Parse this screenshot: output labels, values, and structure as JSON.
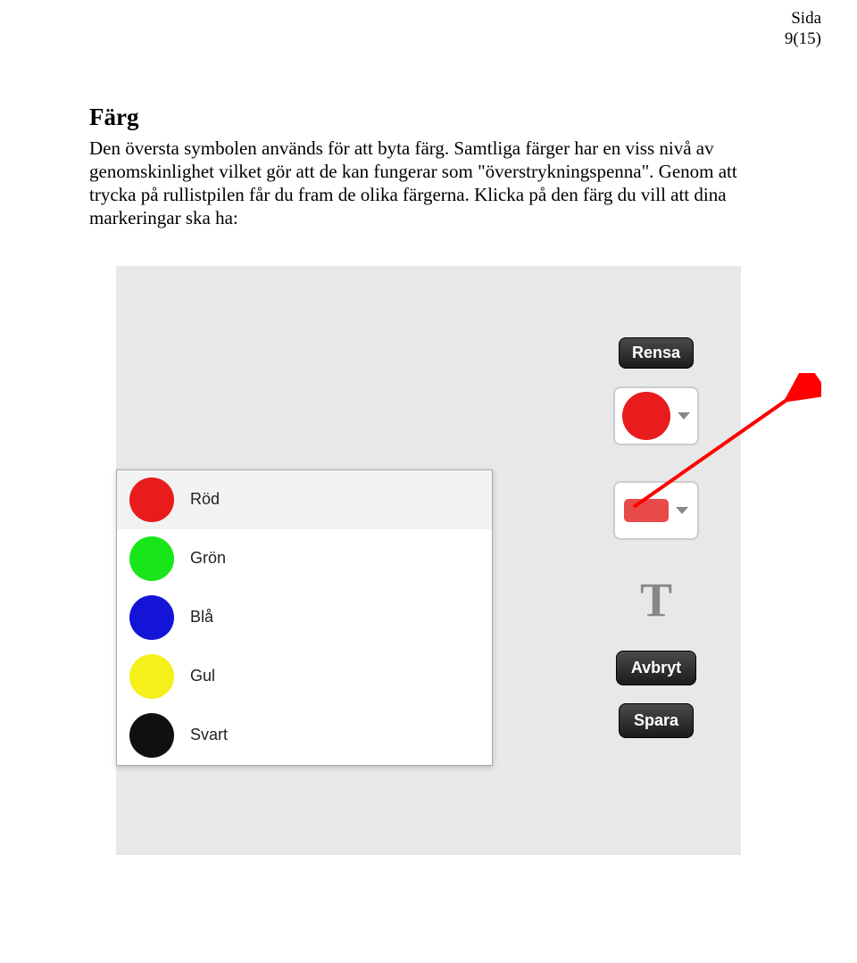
{
  "header": {
    "page_label": "Sida",
    "page_number": "9(15)"
  },
  "section": {
    "title": "Färg",
    "body": "Den översta symbolen används för att byta färg. Samtliga färger har en viss nivå av genomskinlighet vilket gör att de kan fungerar som \"överstrykningspenna\". Genom att trycka på rullistpilen får du fram de olika färgerna. Klicka på den färg du vill att dina markeringar ska ha:"
  },
  "ui": {
    "buttons": {
      "clear": "Rensa",
      "cancel": "Avbryt",
      "save": "Spara"
    },
    "text_tool": "T",
    "current_color": "#e81c1c",
    "rect_color": "#e84a4a",
    "colors": [
      {
        "label": "Röd",
        "hex": "#e81c1c",
        "highlight": true
      },
      {
        "label": "Grön",
        "hex": "#19e619",
        "highlight": false
      },
      {
        "label": "Blå",
        "hex": "#1414d6",
        "highlight": false
      },
      {
        "label": "Gul",
        "hex": "#f5ef1a",
        "highlight": false
      },
      {
        "label": "Svart",
        "hex": "#101010",
        "highlight": false
      }
    ]
  }
}
